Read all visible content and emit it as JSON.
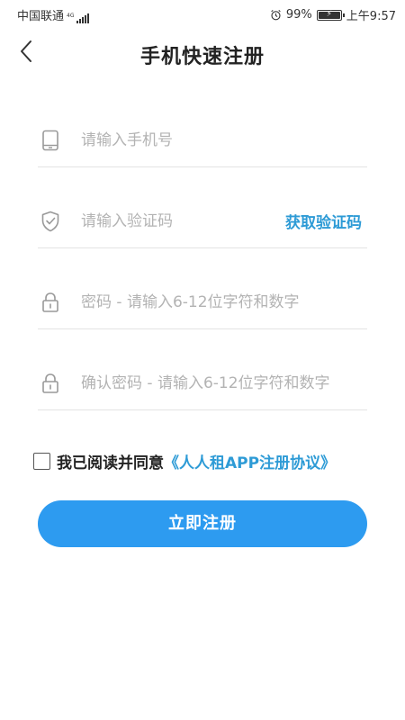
{
  "status_bar": {
    "carrier": "中国联通",
    "network_type": "4G",
    "battery": "99%",
    "battery_level": 0.99,
    "time": "上午9:57",
    "icons": [
      "signal-icon",
      "alarm-icon",
      "battery-icon"
    ]
  },
  "header": {
    "title": "手机快速注册",
    "back_icon": "chevron-left-icon"
  },
  "form": {
    "phone": {
      "placeholder": "请输入手机号",
      "value": "",
      "icon": "phone-icon"
    },
    "code": {
      "placeholder": "请输入验证码",
      "value": "",
      "icon": "shield-check-icon",
      "button_label": "获取验证码"
    },
    "password": {
      "placeholder": "密码 - 请输入6-12位字符和数字",
      "value": "",
      "icon": "lock-icon"
    },
    "confirm_password": {
      "placeholder": "确认密码 - 请输入6-12位字符和数字",
      "value": "",
      "icon": "lock-icon"
    }
  },
  "agreement": {
    "checked": false,
    "text": "我已阅读并同意",
    "link": "《人人租APP注册协议》"
  },
  "submit": {
    "label": "立即注册"
  },
  "colors": {
    "accent": "#2e9bd6",
    "button": "#2d9bf0",
    "divider": "#e3e3e3",
    "placeholder": "#b3b3b3"
  }
}
